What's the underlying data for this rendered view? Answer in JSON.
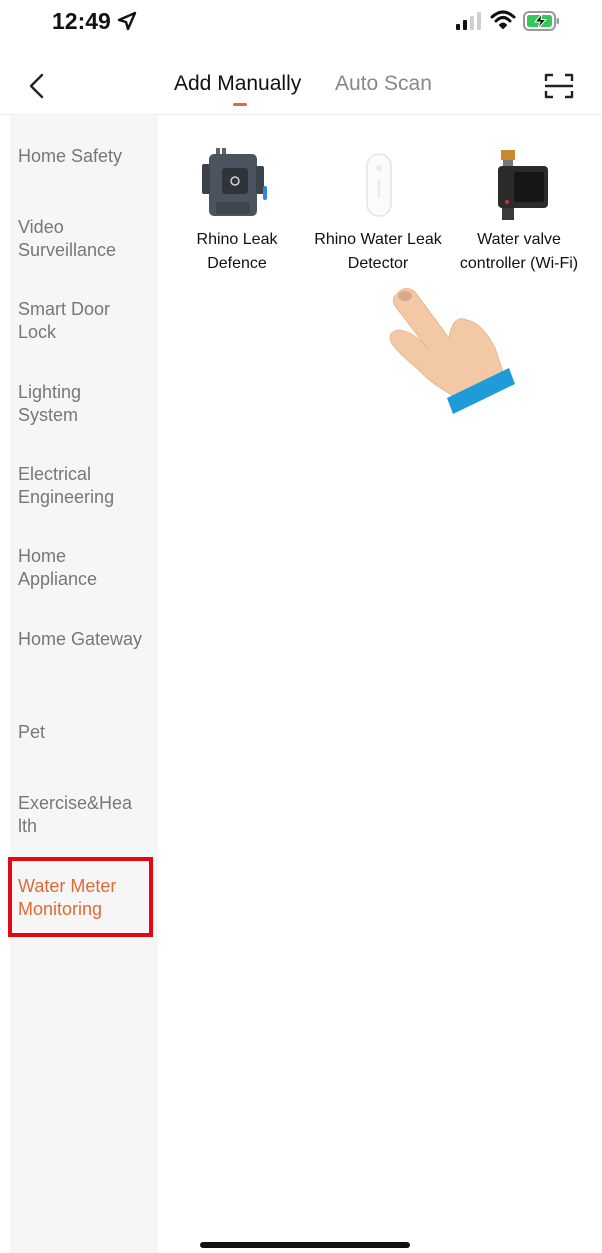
{
  "status_bar": {
    "time": "12:49"
  },
  "nav": {
    "tabs": [
      {
        "label": "Add Manually",
        "active": true
      },
      {
        "label": "Auto Scan",
        "active": false
      }
    ],
    "accent_color": "#e8643c"
  },
  "sidebar": {
    "selected_color": "#e06a35",
    "items": [
      {
        "label": "Home Safety"
      },
      {
        "label": "Video Surveillance"
      },
      {
        "label": "Smart Door Lock"
      },
      {
        "label": "Lighting System"
      },
      {
        "label": "Electrical Engineering"
      },
      {
        "label": "Home Appliance"
      },
      {
        "label": "Home Gateway"
      },
      {
        "label": "Pet"
      },
      {
        "label": "Exercise&Health"
      },
      {
        "label": "Water Meter Monitoring",
        "selected": true
      }
    ]
  },
  "devices": [
    {
      "name": "Rhino Leak Defence",
      "icon": "leak-defence-device-icon"
    },
    {
      "name": "Rhino Water Leak Detector",
      "icon": "leak-detector-device-icon"
    },
    {
      "name": "Water valve controller (Wi-Fi)",
      "icon": "water-valve-controller-icon"
    }
  ],
  "annotation": {
    "highlight_color": "#e30613"
  }
}
